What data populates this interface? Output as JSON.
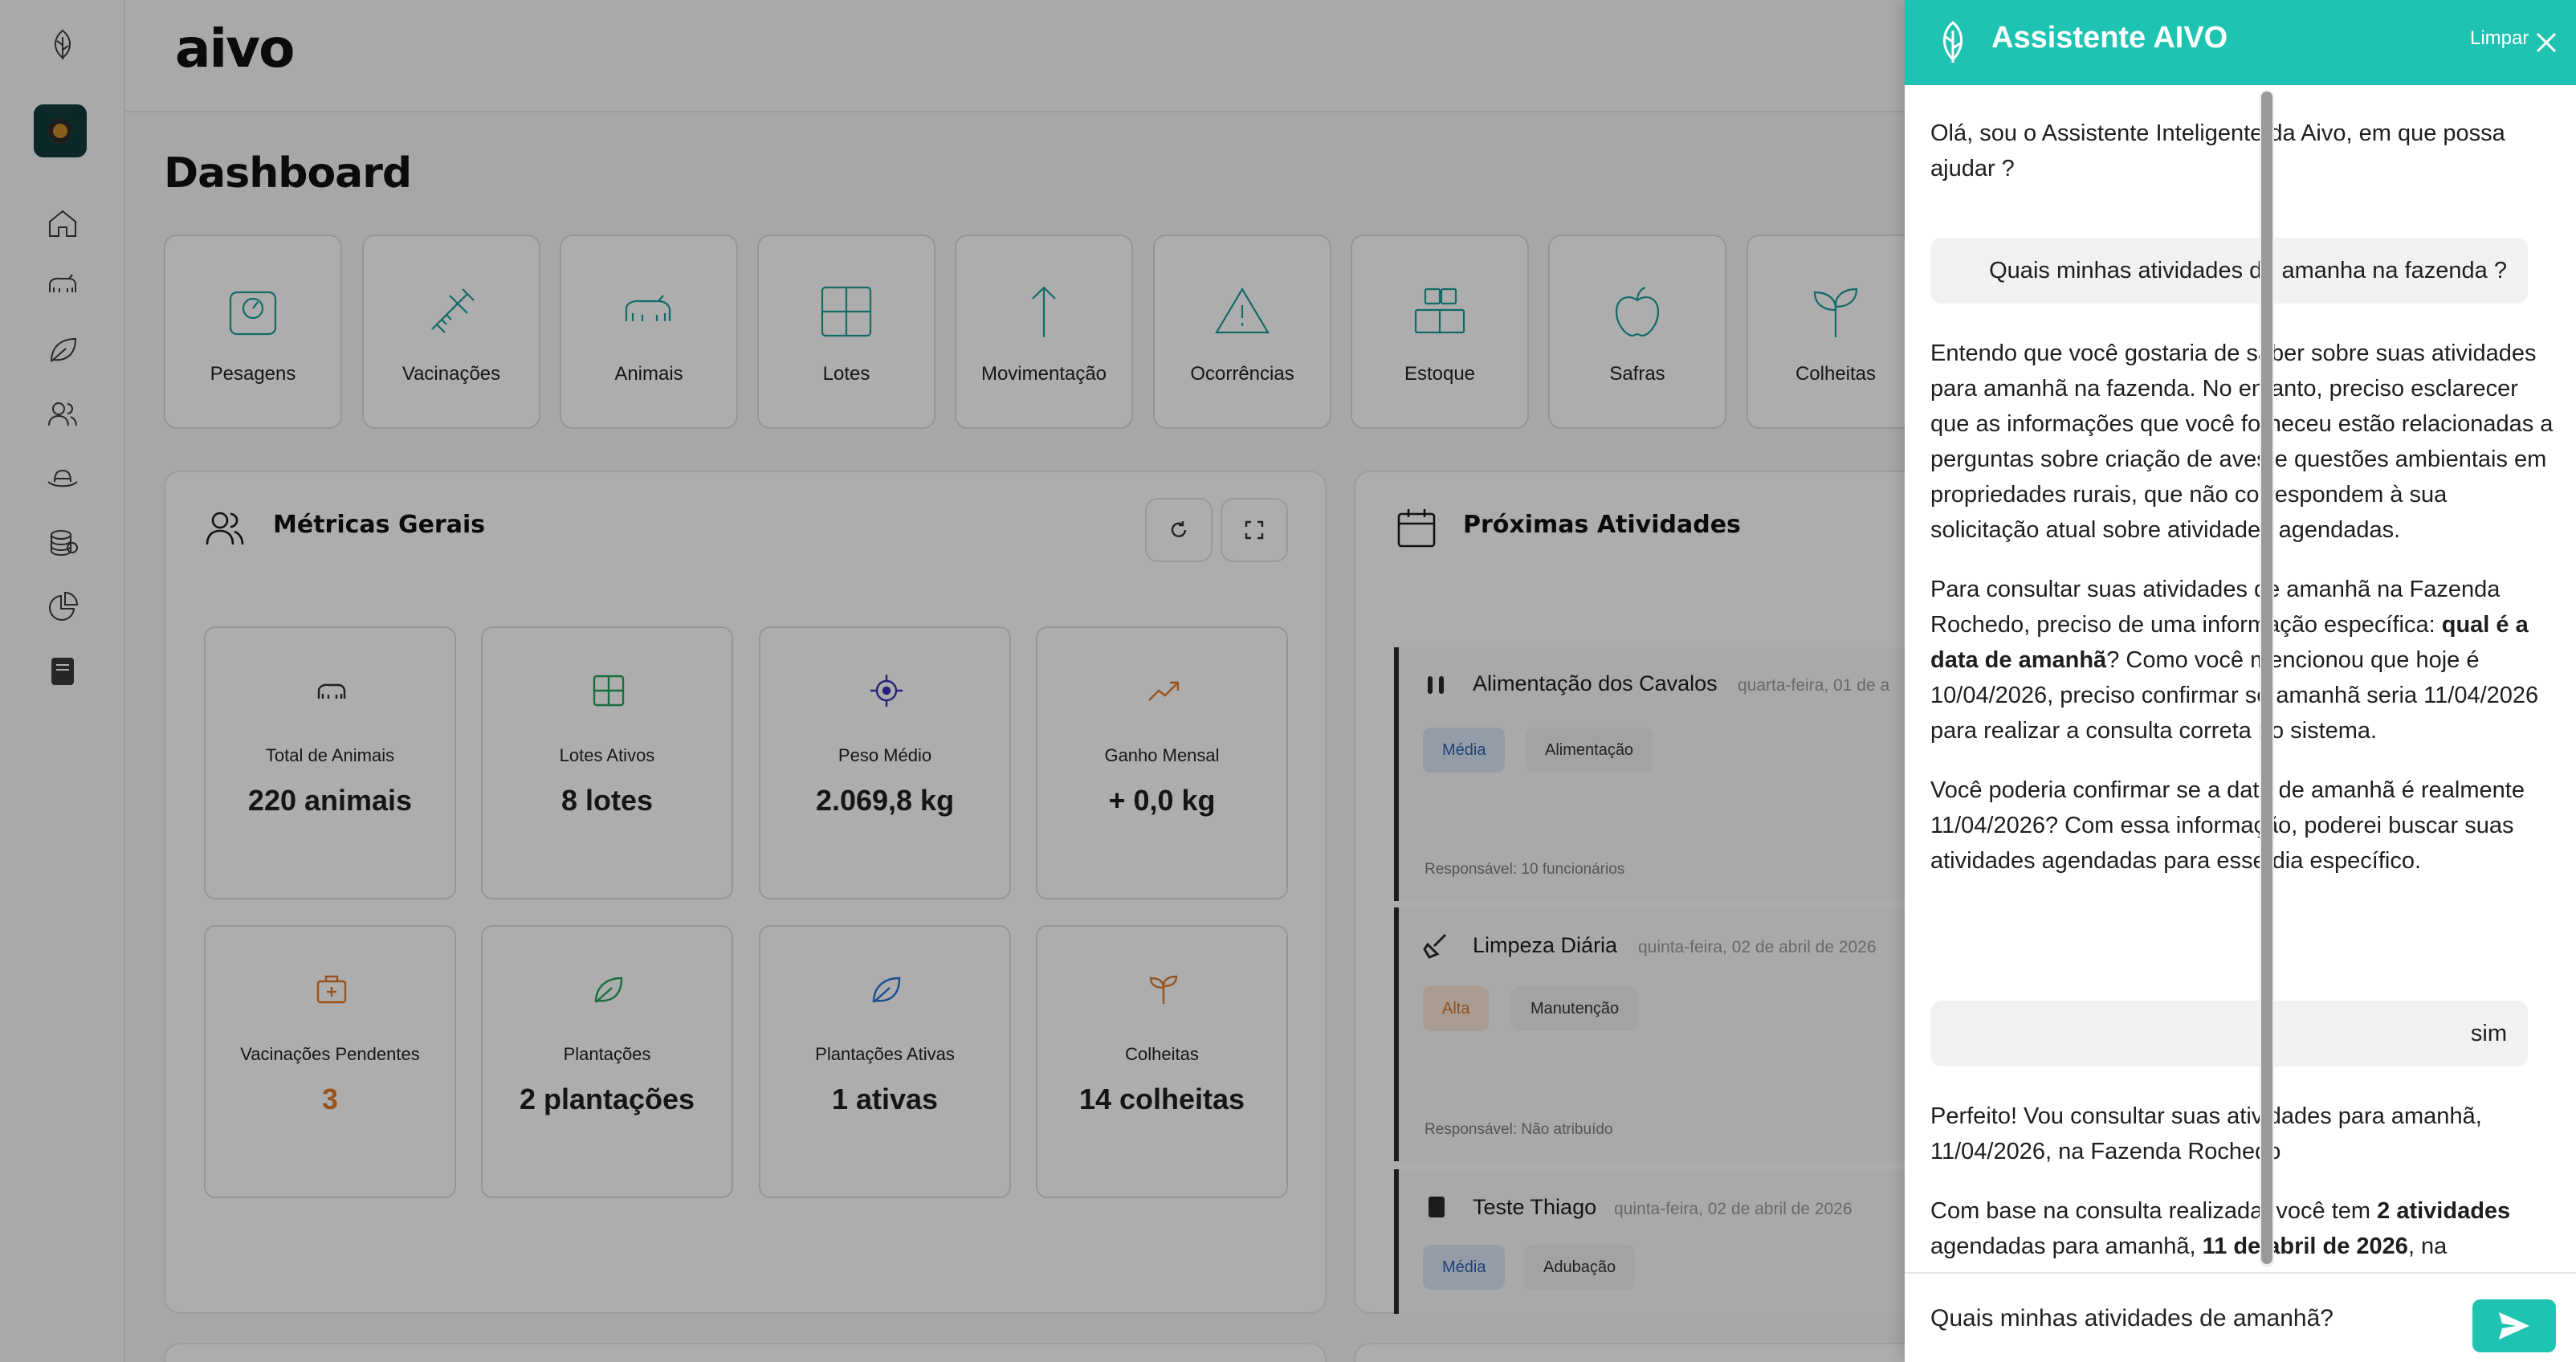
{
  "brand": "aivo",
  "page_title": "Dashboard",
  "quick_actions": [
    "Pesagens",
    "Vacinações",
    "Animais",
    "Lotes",
    "Movimentação",
    "Ocorrências",
    "Estoque",
    "Safras",
    "Colheitas"
  ],
  "metrics_card": {
    "title": "Métricas Gerais",
    "refresh_icon": "refresh-icon",
    "expand_icon": "expand-icon",
    "items": [
      {
        "label": "Total de Animais",
        "value": "220 animais",
        "icon": "cow-icon",
        "color": "#2b2b2b"
      },
      {
        "label": "Lotes Ativos",
        "value": "8 lotes",
        "icon": "grid-icon",
        "color": "#27a35a"
      },
      {
        "label": "Peso Médio",
        "value": "2.069,8 kg",
        "icon": "target-icon",
        "color": "#3b2fb8"
      },
      {
        "label": "Ganho Mensal",
        "value": "+ 0,0 kg",
        "icon": "trending-up-icon",
        "color": "#e07a2a"
      },
      {
        "label": "Vacinações Pendentes",
        "value": "3",
        "icon": "medical-box-icon",
        "color": "#e07a2a"
      },
      {
        "label": "Plantações",
        "value": "2 plantações",
        "icon": "leaf-icon",
        "color": "#27a35a"
      },
      {
        "label": "Plantações Ativas",
        "value": "1 ativas",
        "icon": "leaf-icon",
        "color": "#2472d6"
      },
      {
        "label": "Colheitas",
        "value": "14 colheitas",
        "icon": "sprout-icon",
        "color": "#e07a2a"
      }
    ]
  },
  "activities_card": {
    "title": "Próximas Atividades",
    "items": [
      {
        "title": "Alimentação dos Cavalos",
        "date": "quarta-feira, 01 de a",
        "priority": "Média",
        "category": "Alimentação",
        "responsible": "Responsável: 10 funcionários"
      },
      {
        "title": "Limpeza Diária",
        "date": "quinta-feira, 02 de abril de 2026",
        "priority": "Alta",
        "category": "Manutenção",
        "responsible": "Responsável: Não atribuído"
      },
      {
        "title": "Teste Thiago",
        "date": "quinta-feira, 02 de abril de 2026",
        "priority": "Média",
        "category": "Adubação",
        "responsible": ""
      }
    ]
  },
  "assistant": {
    "title": "Assistente AIVO",
    "clear_label": "Limpar",
    "greeting": "Olá, sou o Assistente Inteligente da Aivo, em que possa ajudar ?",
    "user_msg_1": "Quais minhas atividades de amanha na fazenda ?",
    "bot_reply_1": {
      "p1": "Entendo que você gostaria de saber sobre suas atividades para amanhã na fazenda. No entanto, preciso esclarecer que as informações que você forneceu estão relacionadas a perguntas sobre criação de aves e questões ambientais em propriedades rurais, que não correspondem à sua solicitação atual sobre atividades agendadas.",
      "p2_a": "Para consultar suas atividades de amanhã na Fazenda Rochedo, preciso de uma informação específica: ",
      "p2_b": "qual é a data de amanhã",
      "p2_c": "? Como você mencionou que hoje é 10/04/2026, preciso confirmar se amanhã seria 11/04/2026 para realizar a consulta correta no sistema.",
      "p3": "Você poderia confirmar se a data de amanhã é realmente 11/04/2026? Com essa informação, poderei buscar suas atividades agendadas para esse dia específico."
    },
    "user_msg_2": "sim",
    "bot_reply_2": {
      "p1": "Perfeito! Vou consultar suas atividades para amanhã, 11/04/2026, na Fazenda Rochedo",
      "p2_a": "Com base na consulta realizada, você tem ",
      "p2_b": "2 atividades",
      "p2_c": " agendadas para amanhã, ",
      "p2_d": "11 de abril de 2026",
      "p2_e": ", na"
    },
    "input_value": "Quais minhas atividades de amanhã?",
    "accent": "#1fc3b2"
  }
}
